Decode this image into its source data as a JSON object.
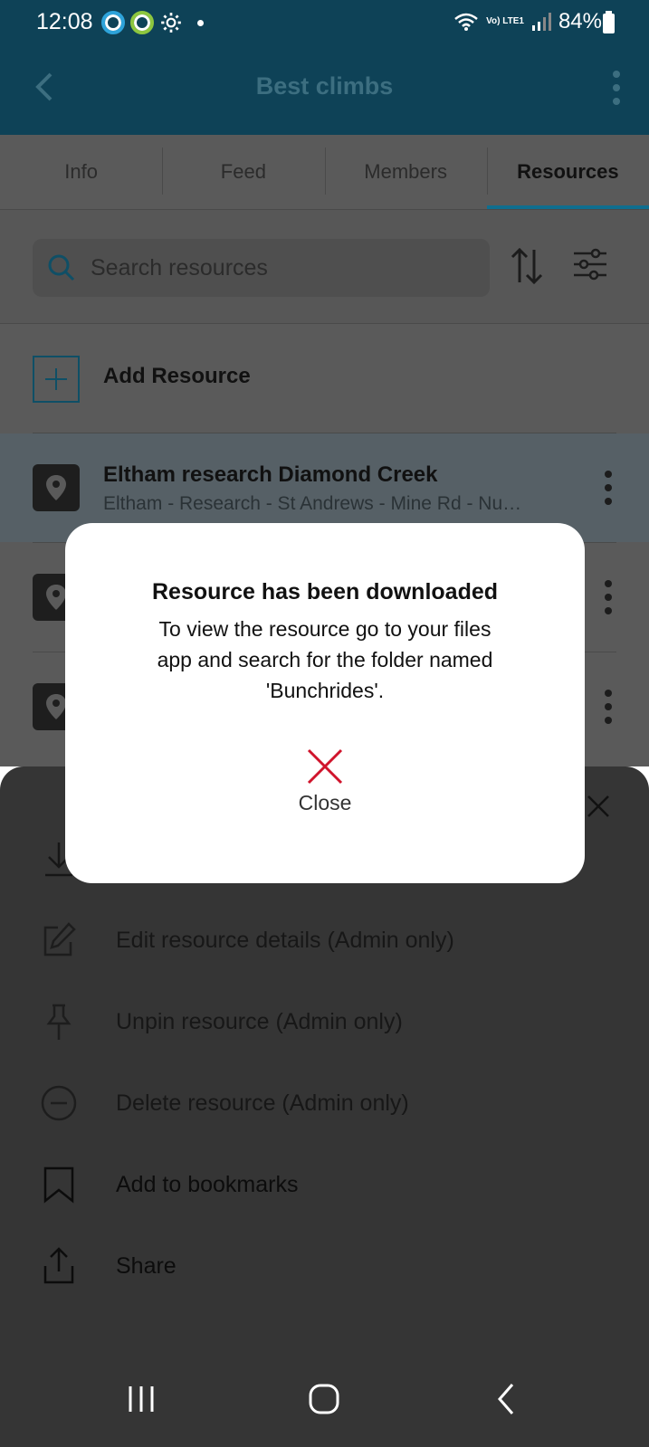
{
  "status_bar": {
    "time": "12:08",
    "network": "Vo) LTE1",
    "battery": "84%"
  },
  "app_bar": {
    "title": "Best climbs"
  },
  "tabs": [
    {
      "label": "Info"
    },
    {
      "label": "Feed"
    },
    {
      "label": "Members"
    },
    {
      "label": "Resources",
      "active": true
    }
  ],
  "search": {
    "placeholder": "Search resources"
  },
  "add_resource": {
    "label": "Add Resource"
  },
  "resources": [
    {
      "name": "Eltham research Diamond Creek",
      "subtitle": "Eltham - Research - St Andrews - Mine Rd - Nu…"
    }
  ],
  "sheet": {
    "options": [
      {
        "label": "Edit resource details (Admin only)",
        "icon": "edit-icon"
      },
      {
        "label": "Unpin resource (Admin only)",
        "icon": "pin-icon"
      },
      {
        "label": "Delete resource (Admin only)",
        "icon": "minus-circle-icon"
      },
      {
        "label": "Add to bookmarks",
        "icon": "bookmark-icon"
      },
      {
        "label": "Share",
        "icon": "share-icon"
      }
    ]
  },
  "dialog": {
    "title": "Resource has been downloaded",
    "message": "To view the resource go to your files app and search for the folder named 'Bunchrides'.",
    "close_label": "Close"
  },
  "colors": {
    "header": "#0e4257",
    "accent": "#0f6e8f",
    "close_red": "#d0142c"
  }
}
